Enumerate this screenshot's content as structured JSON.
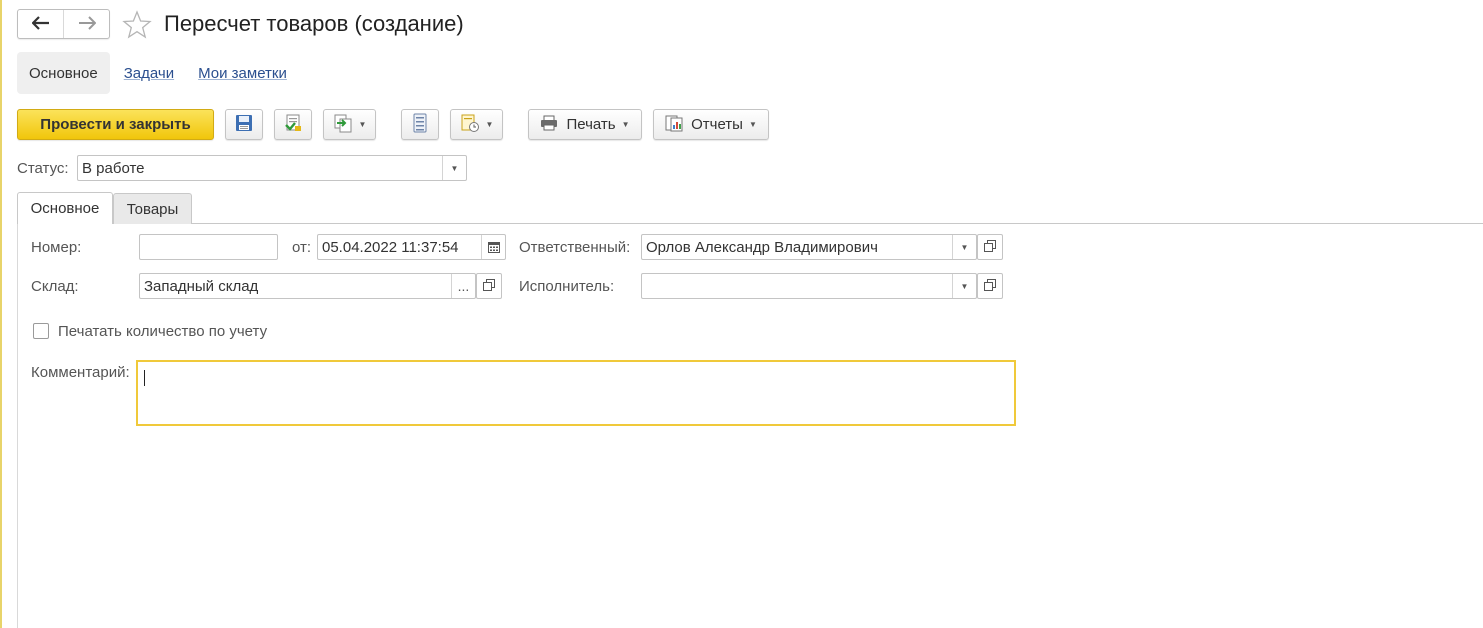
{
  "window": {
    "title": "Пересчет товаров (создание)"
  },
  "nav": {
    "back_icon": "arrow-left-icon",
    "forward_icon": "arrow-right-icon",
    "favorite_icon": "star-icon"
  },
  "sections": [
    {
      "label": "Основное",
      "active": true
    },
    {
      "label": "Задачи",
      "active": false
    },
    {
      "label": "Мои заметки",
      "active": false
    }
  ],
  "toolbar": {
    "post_close_label": "Провести и закрыть",
    "save_icon": "floppy-disk-icon",
    "post_icon": "post-document-icon",
    "create_based_icon": "create-based-on-icon",
    "list_icon": "document-list-icon",
    "related_icon": "related-documents-icon",
    "print_label": "Печать",
    "print_icon": "printer-icon",
    "reports_label": "Отчеты",
    "reports_icon": "reports-icon"
  },
  "status": {
    "label": "Статус:",
    "value": "В работе"
  },
  "tabs": [
    {
      "label": "Основное",
      "active": true
    },
    {
      "label": "Товары",
      "active": false
    }
  ],
  "form": {
    "number_label": "Номер:",
    "number_value": "",
    "date_label": "от:",
    "date_value": "05.04.2022 11:37:54",
    "responsible_label": "Ответственный:",
    "responsible_value": "Орлов Александр Владимирович",
    "warehouse_label": "Склад:",
    "warehouse_value": "Западный склад",
    "warehouse_select": "...",
    "executor_label": "Исполнитель:",
    "executor_value": "",
    "print_qty_label": "Печатать количество по учету",
    "print_qty_checked": false,
    "comment_label": "Комментарий:",
    "comment_value": ""
  },
  "colors": {
    "primary_button": "#f1c60b",
    "link": "#2b4f8f",
    "focus_border": "#f0c93a"
  }
}
